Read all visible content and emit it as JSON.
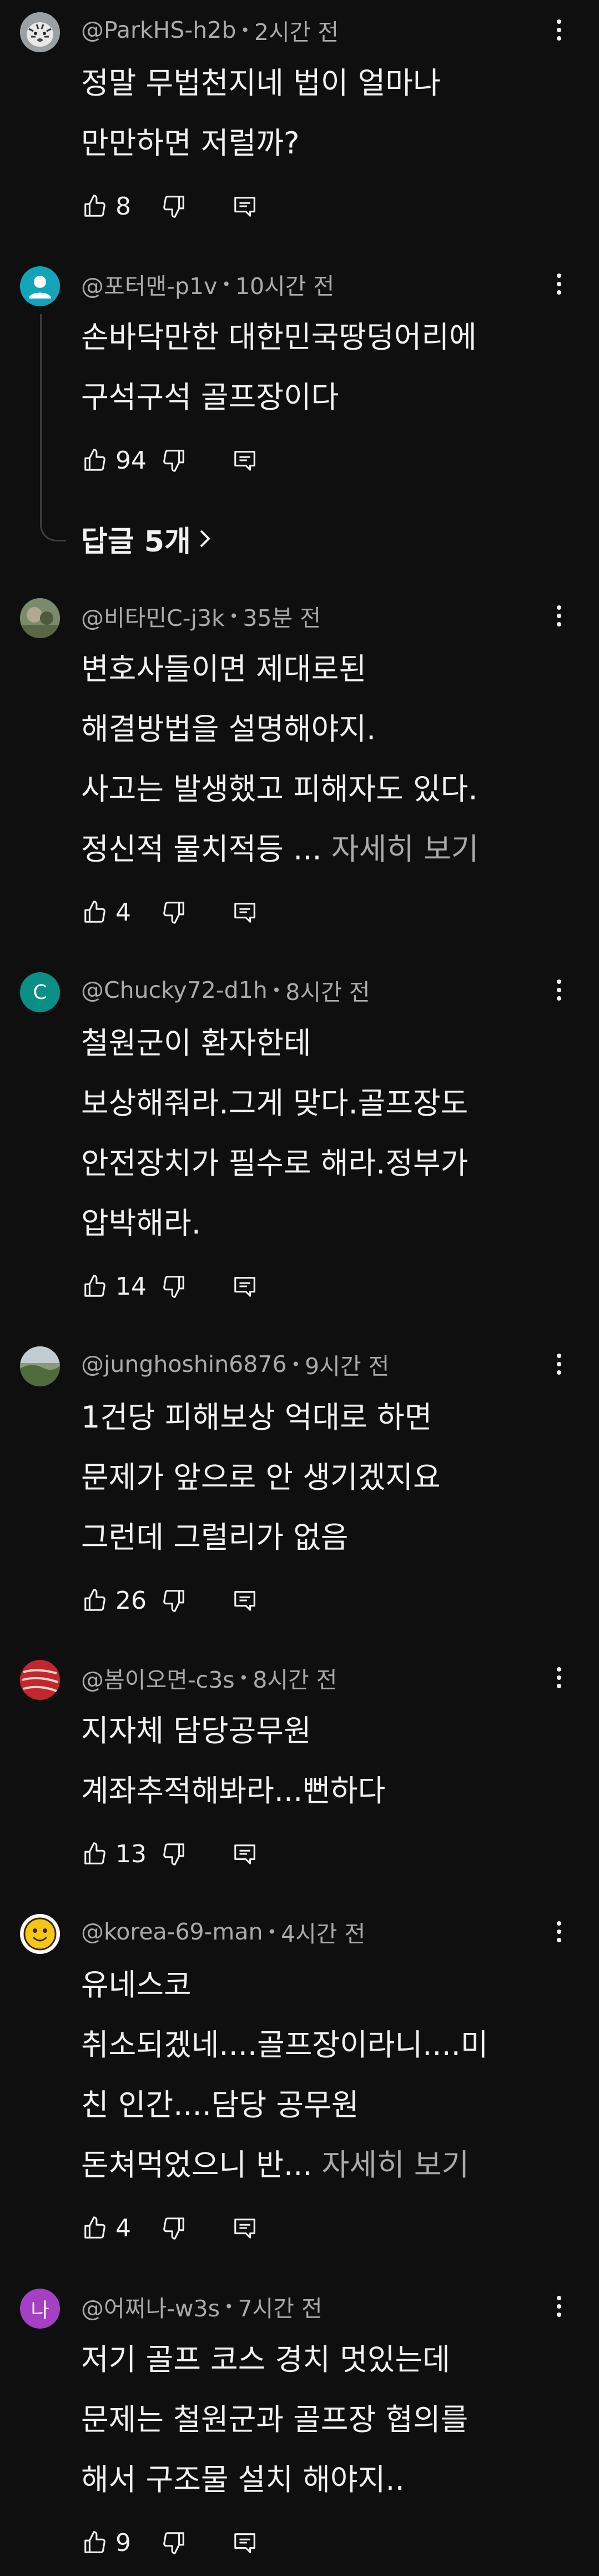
{
  "colors": {
    "background": "#0f0f0f",
    "text_primary": "#f1f1f1",
    "text_secondary": "#aaaaaa",
    "thread_line": "#3f3f3f"
  },
  "icons": {
    "like": "thumb-up-icon",
    "dislike": "thumb-down-icon",
    "reply": "comment-icon",
    "menu": "more-vert-icon"
  },
  "comments": [
    {
      "author": "@ParkHS-h2b",
      "time": "2시간 전",
      "lines": [
        "정말 무법천지네 법이 얼마나",
        "만만하면 저럴까?"
      ],
      "likes": "8",
      "avatar": {
        "kind": "tiger",
        "letter": "",
        "bg": "#8e9497"
      }
    },
    {
      "author": "@포터맨-p1v",
      "time": "10시간 전",
      "lines": [
        "손바닥만한 대한민국땅덩어리에",
        "구석구석 골프장이다"
      ],
      "likes": "94",
      "avatar": {
        "kind": "person",
        "letter": "",
        "bg": "#12a4b8"
      },
      "replies_label": "답글 5개"
    },
    {
      "author": "@비타민C-j3k",
      "time": "35분 전",
      "lines": [
        "변호사들이면 제대로된",
        "해결방법을 설명해야지.",
        "사고는 발생했고 피해자도 있다.",
        "정신적 물치적등 ..."
      ],
      "more_label": "자세히 보기",
      "likes": "4",
      "avatar": {
        "kind": "photo",
        "letter": "",
        "bg": "#5f6a4a"
      }
    },
    {
      "author": "@Chucky72-d1h",
      "time": "8시간 전",
      "lines": [
        "철원군이 환자한테",
        "보상해줘라.그게 맞다.골프장도",
        "안전장치가 필수로  해라.정부가",
        "압박해라."
      ],
      "likes": "14",
      "avatar": {
        "kind": "letter",
        "letter": "C",
        "bg": "#0a8f86"
      }
    },
    {
      "author": "@junghoshin6876",
      "time": "9시간 전",
      "lines": [
        "1건당 피해보상 억대로 하면",
        "문제가 앞으로 안 생기겠지요",
        "그런데 그럴리가 없음"
      ],
      "likes": "26",
      "avatar": {
        "kind": "photo",
        "letter": "",
        "bg": "#6a7a5a"
      }
    },
    {
      "author": "@봄이오면-c3s",
      "time": "8시간 전",
      "lines": [
        "지자체 담당공무원",
        "계좌추적해봐라...뻔하다"
      ],
      "likes": "13",
      "avatar": {
        "kind": "meat",
        "letter": "",
        "bg": "#b8232d"
      }
    },
    {
      "author": "@korea-69-man",
      "time": "4시간 전",
      "lines": [
        "유네스코",
        "취소되겠네....골프장이라니....미",
        "친 인간....담당 공무원",
        "돈쳐먹었으니 반..."
      ],
      "more_label": "자세히 보기",
      "likes": "4",
      "avatar": {
        "kind": "smiley",
        "letter": "",
        "bg": "#f5c518"
      }
    },
    {
      "author": "@어쩌나-w3s",
      "time": "7시간 전",
      "lines": [
        "저기 골프 코스  경치 멋있는데",
        "문제는   철원군과 골프장 협의를",
        "해서 구조물 설치 해야지.."
      ],
      "likes": "9",
      "avatar": {
        "kind": "letter",
        "letter": "나",
        "bg": "#a53fc4"
      }
    }
  ]
}
